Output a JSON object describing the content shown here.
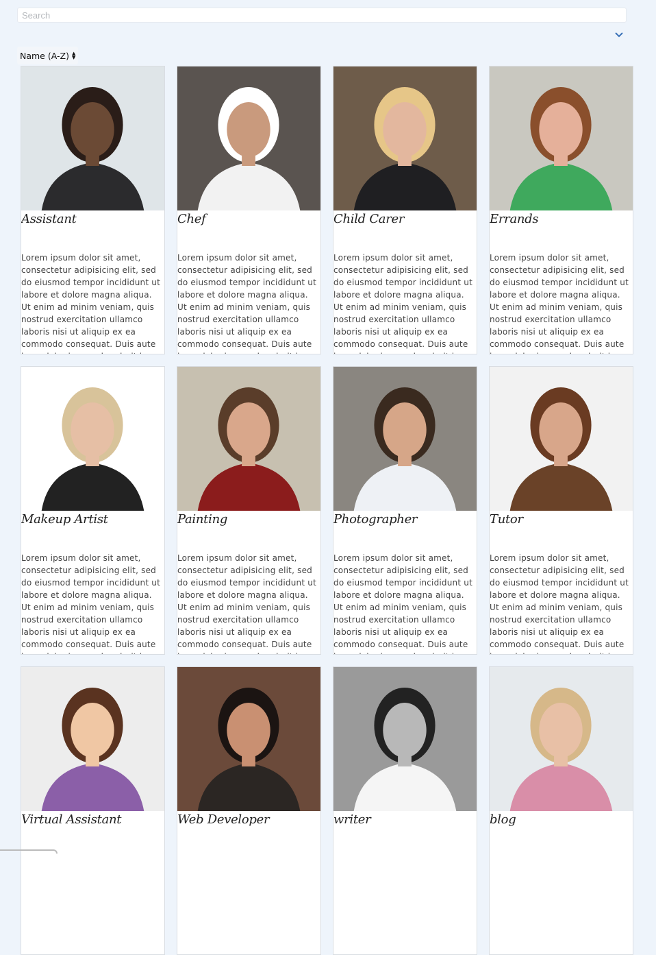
{
  "search": {
    "placeholder": "Search",
    "value": ""
  },
  "sort": {
    "label": "Name (A-Z)"
  },
  "cards": [
    {
      "title": "Assistant",
      "desc": "Lorem ipsum dolor sit amet, consectetur adipisicing elit, sed do eiusmod tempor incididunt ut labore et dolore magna aliqua. Ut enim ad minim veniam, quis nostrud exercitation ullamco laboris nisi ut aliquip ex ea commodo consequat. Duis aute irure dolor in reprehenderit in voluptate velit esse"
    },
    {
      "title": "Chef",
      "desc": "Lorem ipsum dolor sit amet, consectetur adipisicing elit, sed do eiusmod tempor incididunt ut labore et dolore magna aliqua. Ut enim ad minim veniam, quis nostrud exercitation ullamco laboris nisi ut aliquip ex ea commodo consequat. Duis aute irure dolor in reprehenderit in voluptate velit esse"
    },
    {
      "title": "Child Carer",
      "desc": "Lorem ipsum dolor sit amet, consectetur adipisicing elit, sed do eiusmod tempor incididunt ut labore et dolore magna aliqua. Ut enim ad minim veniam, quis nostrud exercitation ullamco laboris nisi ut aliquip ex ea commodo consequat. Duis aute irure dolor in reprehenderit in voluptate velit esse"
    },
    {
      "title": "Errands",
      "desc": "Lorem ipsum dolor sit amet, consectetur adipisicing elit, sed do eiusmod tempor incididunt ut labore et dolore magna aliqua. Ut enim ad minim veniam, quis nostrud exercitation ullamco laboris nisi ut aliquip ex ea commodo consequat. Duis aute irure dolor in reprehenderit in voluptate velit esse"
    },
    {
      "title": "Makeup Artist",
      "desc": "Lorem ipsum dolor sit amet, consectetur adipisicing elit, sed do eiusmod tempor incididunt ut labore et dolore magna aliqua. Ut enim ad minim veniam, quis nostrud exercitation ullamco laboris nisi ut aliquip ex ea commodo consequat. Duis aute irure dolor in reprehenderit in voluptate velit esse"
    },
    {
      "title": "Painting",
      "desc": "Lorem ipsum dolor sit amet, consectetur adipisicing elit, sed do eiusmod tempor incididunt ut labore et dolore magna aliqua. Ut enim ad minim veniam, quis nostrud exercitation ullamco laboris nisi ut aliquip ex ea commodo consequat. Duis aute irure dolor in reprehenderit in voluptate velit esse"
    },
    {
      "title": "Photographer",
      "desc": "Lorem ipsum dolor sit amet, consectetur adipisicing elit, sed do eiusmod tempor incididunt ut labore et dolore magna aliqua. Ut enim ad minim veniam, quis nostrud exercitation ullamco laboris nisi ut aliquip ex ea commodo consequat. Duis aute irure dolor in reprehenderit in voluptate velit esse"
    },
    {
      "title": "Tutor",
      "desc": "Lorem ipsum dolor sit amet, consectetur adipisicing elit, sed do eiusmod tempor incididunt ut labore et dolore magna aliqua. Ut enim ad minim veniam, quis nostrud exercitation ullamco laboris nisi ut aliquip ex ea commodo consequat. Duis aute irure dolor in reprehenderit in voluptate velit esse"
    },
    {
      "title": "Virtual Assistant",
      "desc": ""
    },
    {
      "title": "Web Developer",
      "desc": ""
    },
    {
      "title": "writer",
      "desc": ""
    },
    {
      "title": "blog",
      "desc": ""
    }
  ],
  "photo_colors": [
    {
      "bg": "#dfe5e8",
      "skin": "#6b4a35",
      "hair": "#2a1d18",
      "cloth": "#2b2b2d"
    },
    {
      "bg": "#5a5450",
      "skin": "#c99a7d",
      "hair": "#ffffff",
      "cloth": "#f2f2f2"
    },
    {
      "bg": "#6e5c4a",
      "skin": "#e3b79e",
      "hair": "#e6c688",
      "cloth": "#1f1f22"
    },
    {
      "bg": "#c9c8c0",
      "skin": "#e5b09a",
      "hair": "#8a4f2c",
      "cloth": "#3fa95d"
    },
    {
      "bg": "#ffffff",
      "skin": "#e6bfa5",
      "hair": "#d8c39a",
      "cloth": "#222222"
    },
    {
      "bg": "#c7c0b0",
      "skin": "#d9a78b",
      "hair": "#5a3d2a",
      "cloth": "#8b1c1c"
    },
    {
      "bg": "#8a8680",
      "skin": "#d6a688",
      "hair": "#3a2a1f",
      "cloth": "#eef1f5"
    },
    {
      "bg": "#f2f2f2",
      "skin": "#d8a68a",
      "hair": "#6a3b22",
      "cloth": "#6a4228"
    },
    {
      "bg": "#ededed",
      "skin": "#f0c7a4",
      "hair": "#5a3320",
      "cloth": "#8b5fa8"
    },
    {
      "bg": "#6b4a3a",
      "skin": "#c99072",
      "hair": "#1b1412",
      "cloth": "#2b2623"
    },
    {
      "bg": "#9a9a9a",
      "skin": "#b8b8b8",
      "hair": "#222222",
      "cloth": "#f5f5f5"
    },
    {
      "bg": "#e6eaed",
      "skin": "#e8c0a6",
      "hair": "#d6b889",
      "cloth": "#d98ea8"
    }
  ]
}
